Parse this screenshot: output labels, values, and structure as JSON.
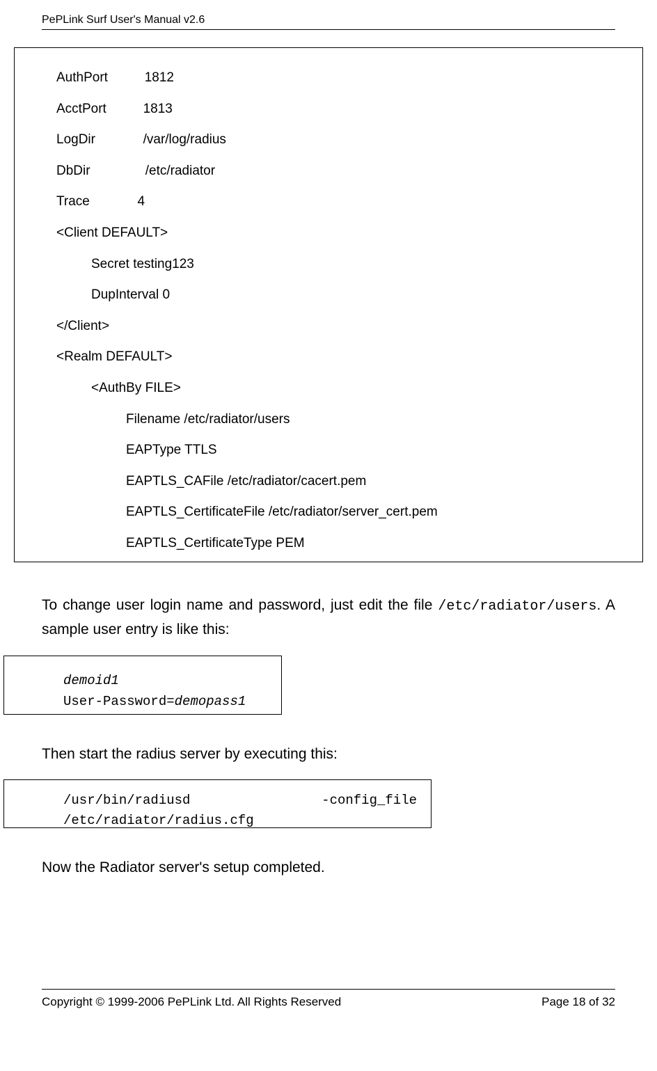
{
  "header": "PePLink Surf User's Manual v2.6",
  "config": {
    "l1": "AuthPort          1812",
    "l2": "AcctPort          1813",
    "l3": "LogDir             /var/log/radius",
    "l4": "DbDir               /etc/radiator",
    "l5": "Trace             4",
    "l6": "<Client DEFAULT>",
    "l7": "Secret testing123",
    "l8": "DupInterval 0",
    "l9": "</Client>",
    "l10": "<Realm DEFAULT>",
    "l11": "<AuthBy FILE>",
    "l12": "Filename /etc/radiator/users",
    "l13": "EAPType TTLS",
    "l14": "EAPTLS_CAFile /etc/radiator/cacert.pem",
    "l15": "EAPTLS_CertificateFile /etc/radiator/server_cert.pem",
    "l16": "EAPTLS_CertificateType PEM"
  },
  "para1a": "To change user login name and password, just edit the file ",
  "para1b": "/etc/radiator/users",
  "para1c": ".   A sample user entry is like this:",
  "userbox": {
    "l1": "demoid1",
    "l2a": "User-Password=",
    "l2b": "demopass1"
  },
  "para2": "Then start the radius server by executing this:",
  "cmdbox": {
    "left": "/usr/bin/radiusd",
    "right": "-config_file",
    "l2": "/etc/radiator/radius.cfg"
  },
  "para3": "Now the Radiator server's setup completed.",
  "footer": {
    "left": "Copyright © 1999-2006 PePLink Ltd. All Rights Reserved",
    "right": "Page 18 of 32"
  }
}
